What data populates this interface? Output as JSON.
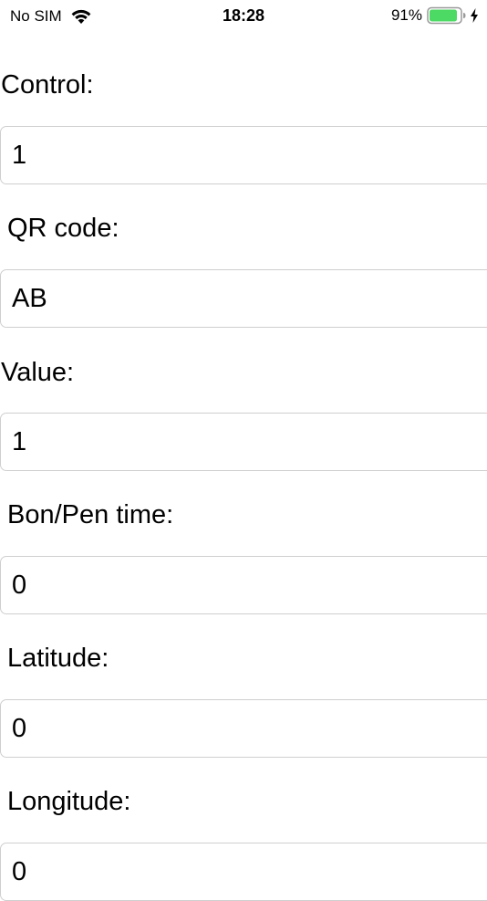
{
  "status_bar": {
    "carrier": "No SIM",
    "time": "18:28",
    "battery_percent": "91%",
    "battery_level": 0.91,
    "battery_color": "#4cd964",
    "icons": [
      "wifi-icon",
      "battery-icon",
      "charging-bolt-icon"
    ]
  },
  "form": {
    "fields": [
      {
        "label": "Control:",
        "value": "1"
      },
      {
        "label": "QR code:",
        "value": "AB"
      },
      {
        "label": "Value:",
        "value": "1"
      },
      {
        "label": "Bon/Pen time:",
        "value": "0"
      },
      {
        "label": "Latitude:",
        "value": "0"
      },
      {
        "label": "Longitude:",
        "value": "0"
      }
    ]
  }
}
